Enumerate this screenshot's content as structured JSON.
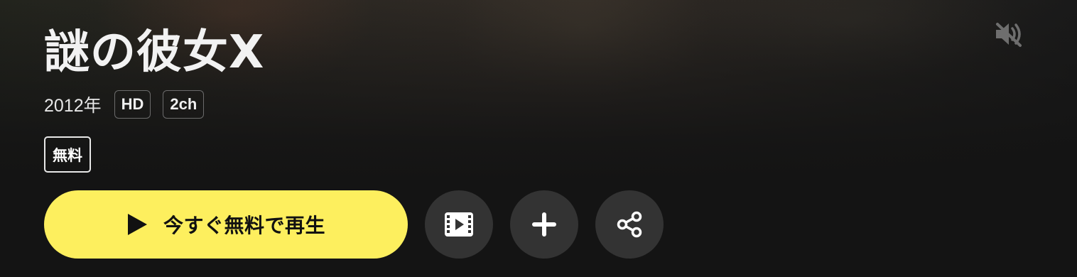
{
  "title": {
    "text": "謎の彼女X"
  },
  "meta": {
    "year": "2012年",
    "badges": [
      "HD",
      "2ch"
    ]
  },
  "tags": {
    "free": "無料"
  },
  "actions": {
    "play_label": "今すぐ無料で再生"
  },
  "icons": {
    "play": "play-icon",
    "trailer": "film-icon",
    "add": "plus-icon",
    "share": "share-icon",
    "mute": "speaker-muted-icon"
  },
  "colors": {
    "play_button": "#fdef5e",
    "round_button": "#333333",
    "background": "#141414"
  }
}
